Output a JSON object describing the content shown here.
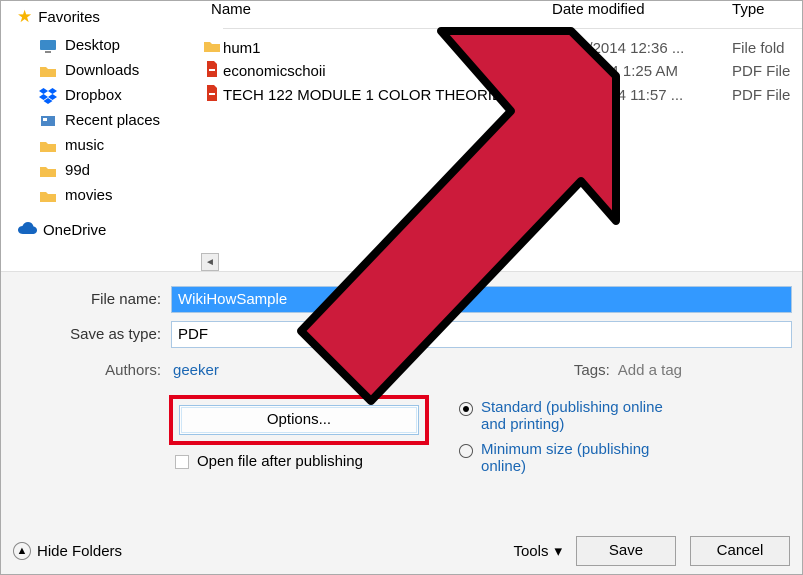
{
  "sidebar": {
    "favorites_label": "Favorites",
    "items": [
      {
        "label": "Desktop",
        "icon": "desktop"
      },
      {
        "label": "Downloads",
        "icon": "folder"
      },
      {
        "label": "Dropbox",
        "icon": "dropbox"
      },
      {
        "label": "Recent places",
        "icon": "recent"
      },
      {
        "label": "music",
        "icon": "folder"
      },
      {
        "label": "99d",
        "icon": "folder"
      },
      {
        "label": "movies",
        "icon": "folder"
      }
    ],
    "onedrive_label": "OneDrive"
  },
  "columns": {
    "name": "Name",
    "date": "Date modified",
    "type": "Type"
  },
  "files": [
    {
      "name": "hum1",
      "date": "11/29/2014 12:36 ...",
      "type": "File fold",
      "icon": "folder"
    },
    {
      "name": "economicschoii",
      "date": "12/3/2014 1:25 AM",
      "type": "PDF File",
      "icon": "pdf"
    },
    {
      "name": "TECH 122 MODULE 1 COLOR THEORIES(2)",
      "date": "11/28/2014 11:57 ...",
      "type": "PDF File",
      "icon": "pdf"
    }
  ],
  "form": {
    "filename_label": "File name:",
    "filename_value": "WikiHowSample",
    "saveas_label": "Save as type:",
    "saveas_value": "PDF",
    "authors_label": "Authors:",
    "authors_value": "geeker",
    "tags_label": "Tags:",
    "tags_value": "Add a tag",
    "options_button": "Options...",
    "open_after_label": "Open file after publishing",
    "radio_standard": "Standard (publishing online and printing)",
    "radio_minimum": "Minimum size (publishing online)"
  },
  "footer": {
    "hide_folders": "Hide Folders",
    "tools": "Tools",
    "save": "Save",
    "cancel": "Cancel"
  }
}
